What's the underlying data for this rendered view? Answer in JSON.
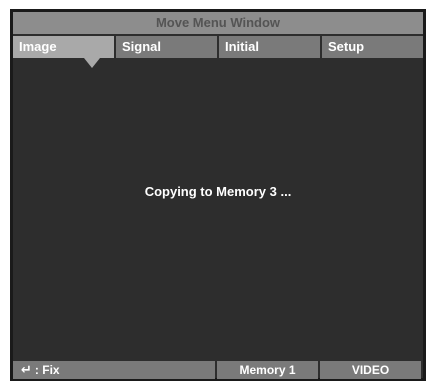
{
  "window": {
    "title": "Move Menu Window"
  },
  "tabs": [
    {
      "label": "Image",
      "active": true
    },
    {
      "label": "Signal",
      "active": false
    },
    {
      "label": "Initial",
      "active": false
    },
    {
      "label": "Setup",
      "active": false
    }
  ],
  "message": "Copying to Memory 3 ...",
  "statusbar": {
    "fix_icon": "enter-return-icon",
    "fix_label": ": Fix",
    "empty_label": "",
    "memory_label": "Memory 1",
    "source_label": "VIDEO"
  }
}
